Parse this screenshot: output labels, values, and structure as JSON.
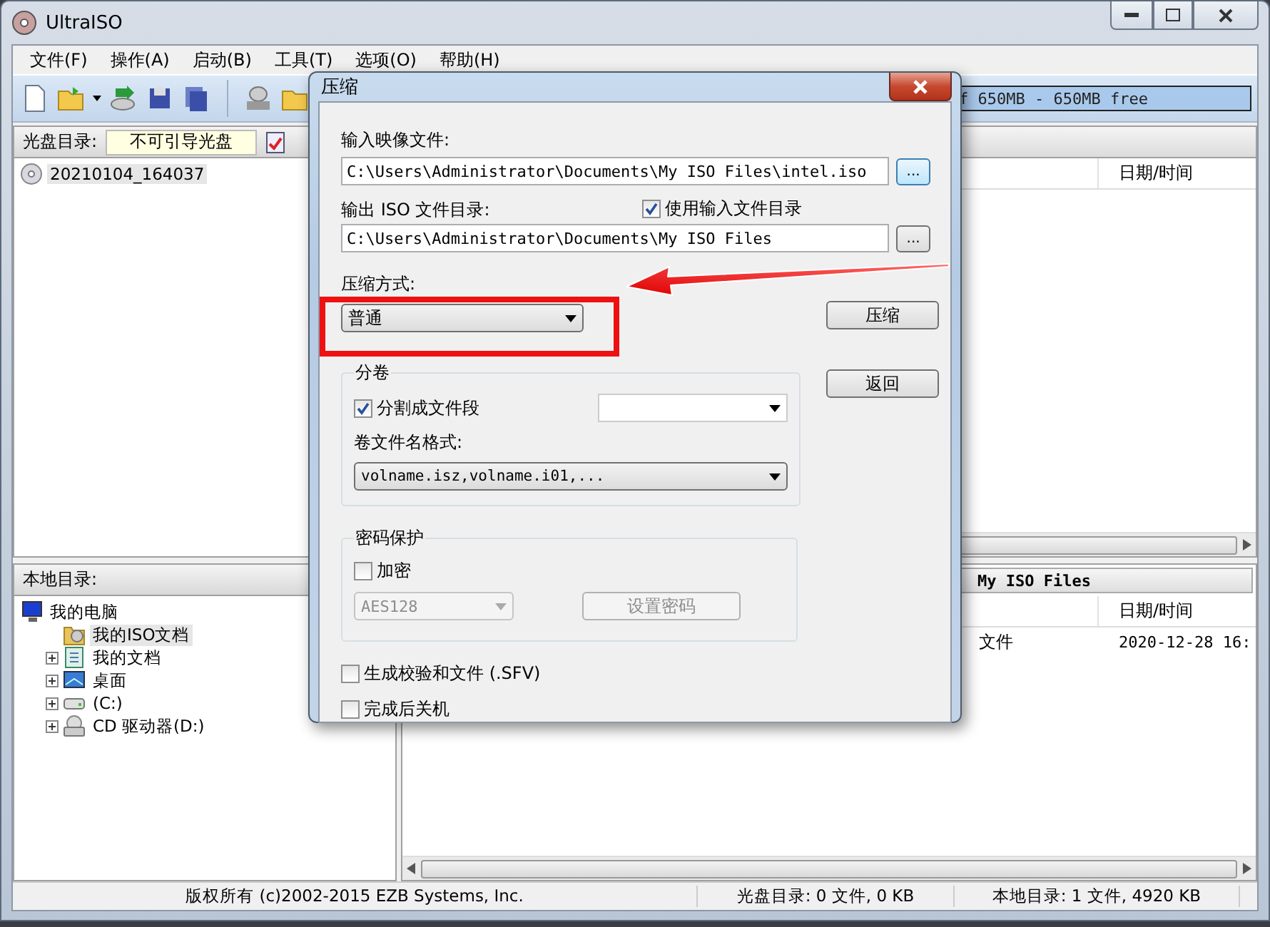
{
  "window": {
    "title": "UltraISO"
  },
  "menu": [
    "文件(F)",
    "操作(A)",
    "启动(B)",
    "工具(T)",
    "选项(O)",
    "帮助(H)"
  ],
  "disc_panel": {
    "label": "光盘目录:",
    "boot_status": "不可引导光盘",
    "capacity": "f 650MB - 650MB free",
    "columns": [
      "日期/时间"
    ],
    "tree": [
      {
        "label": "20210104_164037",
        "kind": "disc",
        "selected": true
      }
    ]
  },
  "local_panel": {
    "label": "本地目录:",
    "path": "My ISO Files",
    "columns": [
      "日期/时间"
    ],
    "rows": [
      {
        "column_1": "文件",
        "column_2": "2020-12-28 16:"
      }
    ],
    "tree": [
      {
        "label": "我的电脑",
        "kind": "computer",
        "selected": false,
        "children": [
          {
            "label": "我的ISO文档",
            "kind": "iso-folder",
            "selected": true
          },
          {
            "label": "我的文档",
            "kind": "documents",
            "selected": false,
            "expanded": false
          },
          {
            "label": "桌面",
            "kind": "desktop",
            "selected": false,
            "expanded": false
          },
          {
            "label": "(C:)",
            "kind": "drive",
            "selected": false,
            "expanded": false
          },
          {
            "label": "CD 驱动器(D:)",
            "kind": "cd-drive",
            "selected": false,
            "expanded": false
          }
        ]
      }
    ]
  },
  "status_bar": [
    "版权所有 (c)2002-2015 EZB Systems, Inc.",
    "光盘目录: 0 文件, 0 KB",
    "本地目录: 1 文件, 4920 KB"
  ],
  "dialog": {
    "title": "压缩",
    "input_label": "输入映像文件:",
    "input_value": "C:\\Users\\Administrator\\Documents\\My ISO Files\\intel.iso",
    "input_browse": "...",
    "output_browse": "...",
    "output_label": "输出 ISO 文件目录:",
    "use_input_dir": {
      "label": "使用输入文件目录",
      "checked": true
    },
    "output_value": "C:\\Users\\Administrator\\Documents\\My ISO Files",
    "method_label": "压缩方式:",
    "method_value": "普通",
    "split_group": {
      "title": "分卷",
      "split": {
        "label": "分割成文件段",
        "checked": true
      },
      "format_label": "卷文件名格式:",
      "format_value": "volname.isz,volname.i01,..."
    },
    "password_group": {
      "title": "密码保护",
      "encrypt": {
        "label": "加密",
        "checked": false
      },
      "algorithm": {
        "value": "AES128",
        "disabled": true
      },
      "set_password": {
        "label": "设置密码",
        "disabled": true
      }
    },
    "checksum": {
      "label": "生成校验和文件 (.SFV)",
      "checked": false
    },
    "shutdown": {
      "label": "完成后关机",
      "checked": false
    },
    "buttons": [
      "压缩",
      "返回"
    ]
  }
}
